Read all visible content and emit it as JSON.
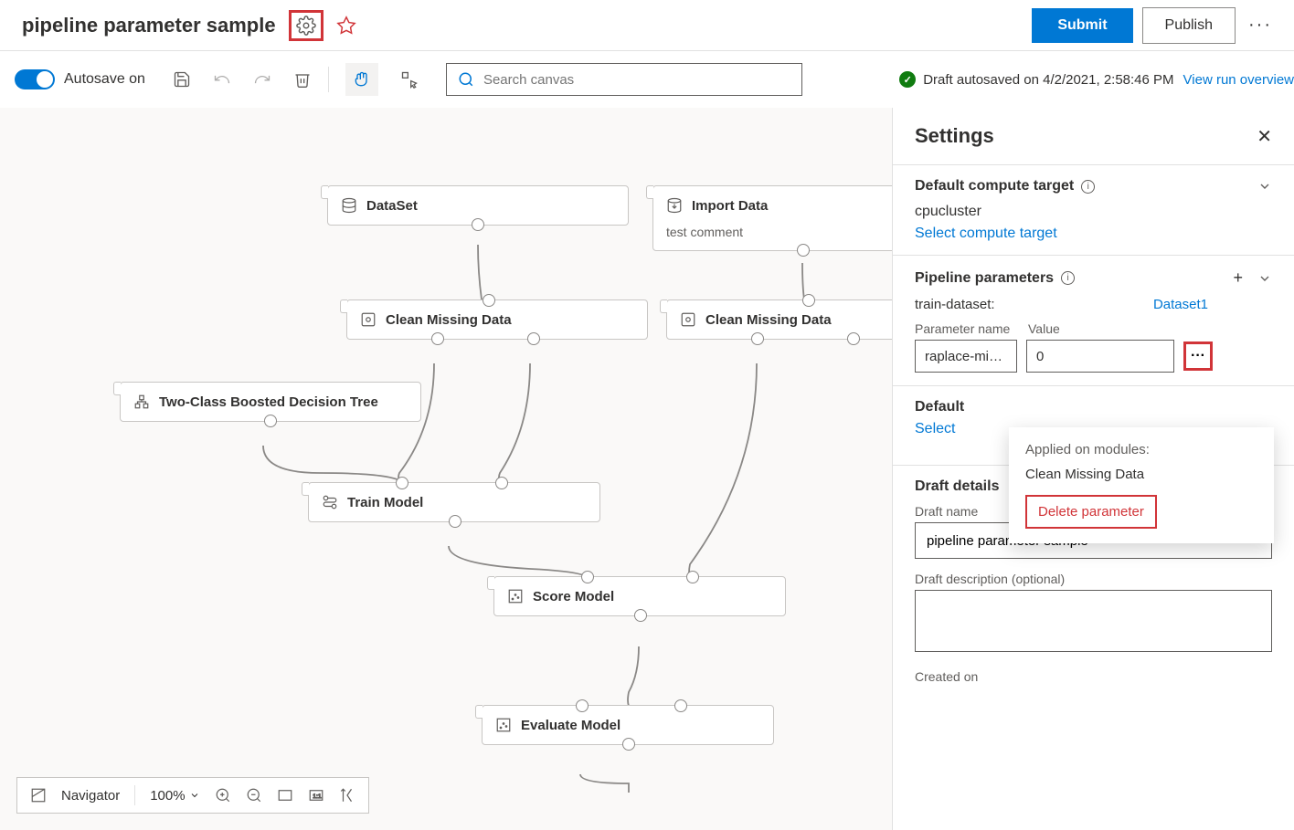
{
  "header": {
    "title": "pipeline parameter sample",
    "submit": "Submit",
    "publish": "Publish"
  },
  "toolbar": {
    "autosave": "Autosave on",
    "search_placeholder": "Search canvas",
    "status": "Draft autosaved on 4/2/2021, 2:58:46 PM",
    "view_link": "View run overview"
  },
  "nodes": {
    "dataset": "DataSet",
    "import_data": "Import Data",
    "import_sub": "test comment",
    "clean1": "Clean Missing Data",
    "clean2": "Clean Missing Data",
    "two_class": "Two-Class Boosted Decision Tree",
    "train": "Train Model",
    "score": "Score Model",
    "evaluate": "Evaluate Model"
  },
  "settings": {
    "title": "Settings",
    "compute": {
      "title": "Default compute target",
      "name": "cpucluster",
      "link": "Select compute target"
    },
    "params": {
      "title": "Pipeline parameters",
      "row_label": "train-dataset:",
      "row_value": "Dataset1",
      "name_label": "Parameter name",
      "value_label": "Value",
      "name_value": "raplace-miss...",
      "value_value": "0"
    },
    "popup": {
      "applied": "Applied on modules:",
      "module": "Clean Missing Data",
      "delete": "Delete parameter"
    },
    "partial": {
      "title": "Default",
      "link": "Select"
    },
    "draft": {
      "title": "Draft details",
      "name_label": "Draft name",
      "name_value": "pipeline parameter sample",
      "desc_label": "Draft description (optional)",
      "created_label": "Created on"
    }
  },
  "bottom": {
    "navigator": "Navigator",
    "zoom": "100%"
  }
}
